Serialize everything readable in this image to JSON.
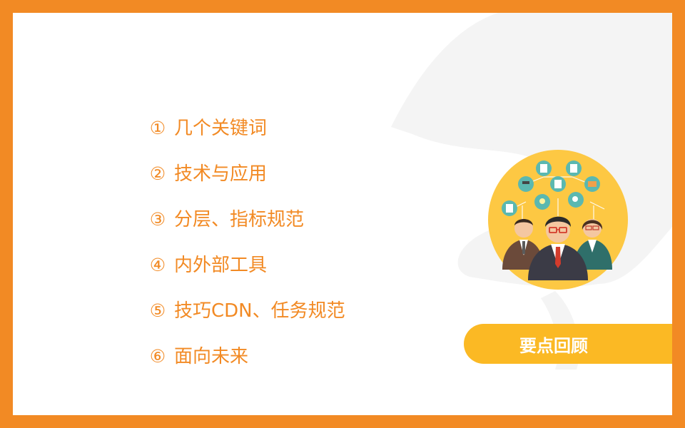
{
  "agenda": {
    "items": [
      {
        "num": "①",
        "label": "几个关键词"
      },
      {
        "num": "②",
        "label": "技术与应用"
      },
      {
        "num": "③",
        "label": "分层、指标规范"
      },
      {
        "num": "④",
        "label": "内外部工具"
      },
      {
        "num": "⑤",
        "label": "技巧CDN、任务规范"
      },
      {
        "num": "⑥",
        "label": "面向未来"
      }
    ]
  },
  "review_button": {
    "label": "要点回顾"
  },
  "colors": {
    "frame": "#f28a24",
    "accent_text": "#f28a24",
    "button": "#fbb924",
    "illustration_circle": "#fdc843",
    "background_shape": "#f4f4f4"
  },
  "icons": [
    "people-illustration",
    "network-icons"
  ]
}
